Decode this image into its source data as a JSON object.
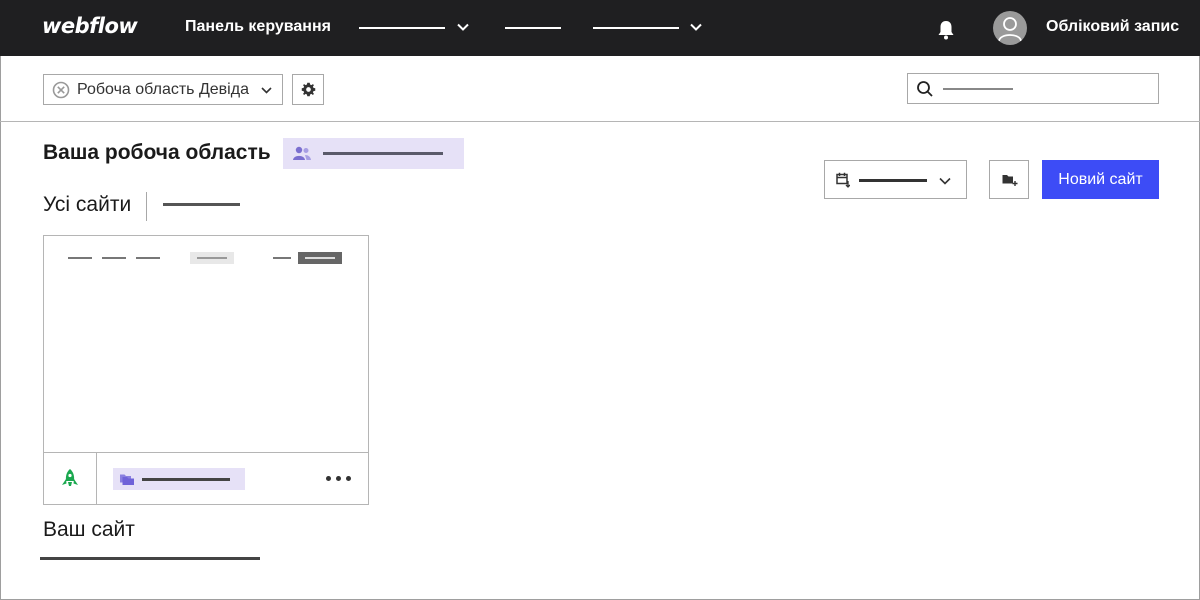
{
  "topbar": {
    "logo": "webflow",
    "nav_dashboard": "Панель керування",
    "account_label": "Обліковий запис",
    "icons": [
      "chevron-down-icon",
      "bell-icon",
      "avatar-icon"
    ]
  },
  "toolbar": {
    "workspace_select": "Робоча область Девіда",
    "search_placeholder": ""
  },
  "header": {
    "workspace_title": "Ваша робоча область",
    "new_site_button": "Новий сайт"
  },
  "filters": {
    "all_sites": "Усі сайти"
  },
  "site_card": {
    "name": "Ваш сайт",
    "status_icon": "rocket-icon"
  },
  "colors": {
    "topbar_bg": "#1f1f21",
    "accent": "#3d4cf6",
    "badge_bg": "#e6e1f7",
    "published_green": "#1aa84f"
  }
}
